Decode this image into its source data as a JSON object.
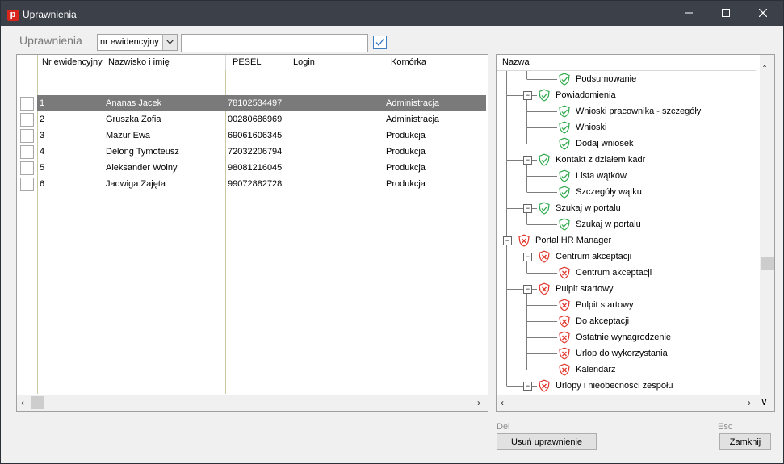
{
  "window": {
    "title": "Uprawnienia",
    "app_icon_letter": "p"
  },
  "filter": {
    "label": "Uprawnienia",
    "field_select_value": "nr ewidencyjny",
    "search_value": "",
    "checkbox_checked": true
  },
  "employees": {
    "columns": [
      "Nr ewidencyjny",
      "Nazwisko i imię",
      "PESEL",
      "Login",
      "Komórka"
    ],
    "rows": [
      {
        "nr": "1",
        "name": "Ananas Jacek",
        "pesel": "78102534497",
        "login": "",
        "unit": "Administracja",
        "selected": true
      },
      {
        "nr": "2",
        "name": "Gruszka Zofia",
        "pesel": "00280686969",
        "login": "",
        "unit": "Administracja",
        "selected": false
      },
      {
        "nr": "3",
        "name": "Mazur Ewa",
        "pesel": "69061606345",
        "login": "",
        "unit": "Produkcja",
        "selected": false
      },
      {
        "nr": "4",
        "name": "Delong Tymoteusz",
        "pesel": "72032206794",
        "login": "",
        "unit": "Produkcja",
        "selected": false
      },
      {
        "nr": "5",
        "name": "Aleksander  Wolny",
        "pesel": "98081216045",
        "login": "",
        "unit": "Produkcja",
        "selected": false
      },
      {
        "nr": "6",
        "name": "Jadwiga Zajęta",
        "pesel": "99072882728",
        "login": "",
        "unit": "Produkcja",
        "selected": false
      }
    ]
  },
  "tree": {
    "header": "Nazwa",
    "nodes": [
      {
        "label": "Podsumowanie",
        "level": 2,
        "status": "granted",
        "expandable": false
      },
      {
        "label": "Powiadomienia",
        "level": 1,
        "status": "granted",
        "expandable": true
      },
      {
        "label": "Wnioski pracownika - szczegóły",
        "level": 2,
        "status": "granted",
        "expandable": false
      },
      {
        "label": "Wnioski",
        "level": 2,
        "status": "granted",
        "expandable": false
      },
      {
        "label": "Dodaj wniosek",
        "level": 2,
        "status": "granted",
        "expandable": false
      },
      {
        "label": "Kontakt z działem kadr",
        "level": 1,
        "status": "granted",
        "expandable": true
      },
      {
        "label": "Lista wątków",
        "level": 2,
        "status": "granted",
        "expandable": false
      },
      {
        "label": "Szczegóły wątku",
        "level": 2,
        "status": "granted",
        "expandable": false
      },
      {
        "label": "Szukaj w portalu",
        "level": 1,
        "status": "granted",
        "expandable": true
      },
      {
        "label": "Szukaj w portalu",
        "level": 2,
        "status": "granted",
        "expandable": false
      },
      {
        "label": "Portal HR  Manager",
        "level": 0,
        "status": "denied",
        "expandable": true
      },
      {
        "label": "Centrum akceptacji",
        "level": 1,
        "status": "denied",
        "expandable": true
      },
      {
        "label": "Centrum akceptacji",
        "level": 2,
        "status": "denied",
        "expandable": false
      },
      {
        "label": "Pulpit startowy",
        "level": 1,
        "status": "denied",
        "expandable": true
      },
      {
        "label": "Pulpit startowy",
        "level": 2,
        "status": "denied",
        "expandable": false
      },
      {
        "label": "Do akceptacji",
        "level": 2,
        "status": "denied",
        "expandable": false
      },
      {
        "label": "Ostatnie wynagrodzenie",
        "level": 2,
        "status": "denied",
        "expandable": false
      },
      {
        "label": "Urlop do wykorzystania",
        "level": 2,
        "status": "denied",
        "expandable": false
      },
      {
        "label": "Kalendarz",
        "level": 2,
        "status": "denied",
        "expandable": false
      },
      {
        "label": "Urlopy i nieobecności zespołu",
        "level": 1,
        "status": "denied",
        "expandable": true
      }
    ]
  },
  "actions": {
    "remove_shortcut": "Del",
    "remove_label": "Usuń uprawnienie",
    "close_shortcut": "Esc",
    "close_label": "Zamknij"
  },
  "colors": {
    "granted": "#2ea84a",
    "denied": "#e0352b",
    "selected_row": "#7a7a7a",
    "titlebar": "#3b4049"
  }
}
